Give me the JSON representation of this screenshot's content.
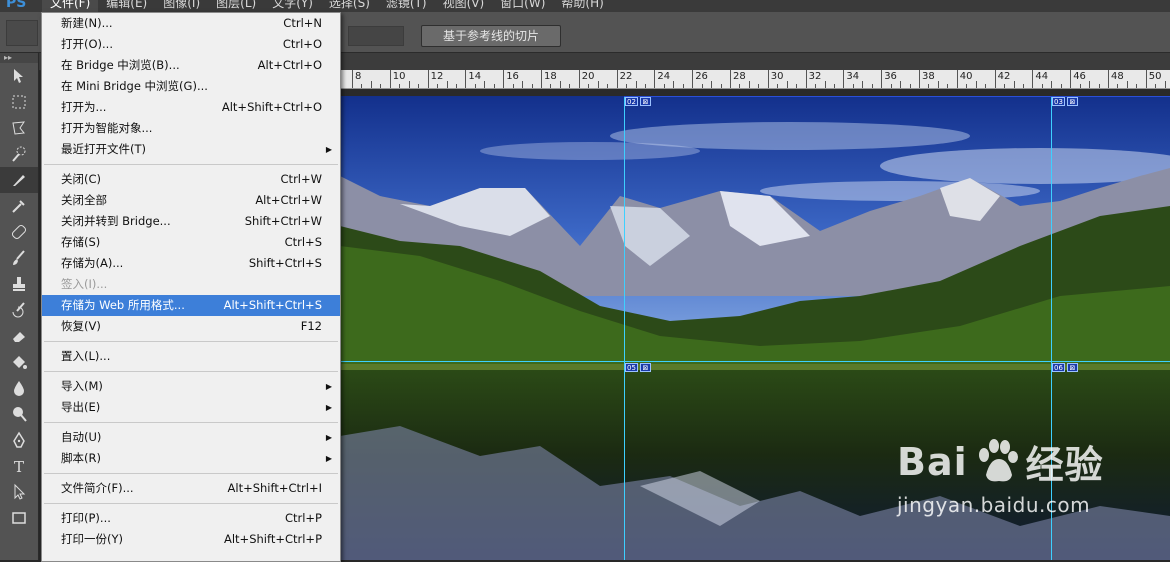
{
  "app": {
    "logo": "PS"
  },
  "menubar": {
    "items": [
      "文件(F)",
      "编辑(E)",
      "图像(I)",
      "图层(L)",
      "文字(Y)",
      "选择(S)",
      "滤镜(T)",
      "视图(V)",
      "窗口(W)",
      "帮助(H)"
    ]
  },
  "options_bar": {
    "slice_from_guides_label": "基于参考线的切片"
  },
  "ruler": {
    "labels": [
      "8",
      "10",
      "12",
      "14",
      "16",
      "18",
      "20",
      "22",
      "24",
      "26",
      "28",
      "30",
      "32",
      "34",
      "36",
      "38",
      "40",
      "42",
      "44",
      "46",
      "48",
      "50"
    ]
  },
  "slices": [
    {
      "num": "02"
    },
    {
      "num": "03"
    },
    {
      "num": "05"
    },
    {
      "num": "06"
    }
  ],
  "file_menu": {
    "items": [
      {
        "label": "新建(N)...",
        "shortcut": "Ctrl+N"
      },
      {
        "label": "打开(O)...",
        "shortcut": "Ctrl+O"
      },
      {
        "label": "在 Bridge 中浏览(B)...",
        "shortcut": "Alt+Ctrl+O"
      },
      {
        "label": "在 Mini Bridge 中浏览(G)...",
        "shortcut": ""
      },
      {
        "label": "打开为...",
        "shortcut": "Alt+Shift+Ctrl+O"
      },
      {
        "label": "打开为智能对象...",
        "shortcut": ""
      },
      {
        "label": "最近打开文件(T)",
        "shortcut": "",
        "submenu": true
      },
      {
        "sep": true
      },
      {
        "label": "关闭(C)",
        "shortcut": "Ctrl+W"
      },
      {
        "label": "关闭全部",
        "shortcut": "Alt+Ctrl+W"
      },
      {
        "label": "关闭并转到 Bridge...",
        "shortcut": "Shift+Ctrl+W"
      },
      {
        "label": "存储(S)",
        "shortcut": "Ctrl+S"
      },
      {
        "label": "存储为(A)...",
        "shortcut": "Shift+Ctrl+S"
      },
      {
        "label": "签入(I)...",
        "shortcut": "",
        "disabled": true
      },
      {
        "label": "存储为 Web 所用格式...",
        "shortcut": "Alt+Shift+Ctrl+S",
        "highlighted": true
      },
      {
        "label": "恢复(V)",
        "shortcut": "F12"
      },
      {
        "sep": true
      },
      {
        "label": "置入(L)...",
        "shortcut": ""
      },
      {
        "sep": true
      },
      {
        "label": "导入(M)",
        "shortcut": "",
        "submenu": true
      },
      {
        "label": "导出(E)",
        "shortcut": "",
        "submenu": true
      },
      {
        "sep": true
      },
      {
        "label": "自动(U)",
        "shortcut": "",
        "submenu": true
      },
      {
        "label": "脚本(R)",
        "shortcut": "",
        "submenu": true
      },
      {
        "sep": true
      },
      {
        "label": "文件简介(F)...",
        "shortcut": "Alt+Shift+Ctrl+I"
      },
      {
        "sep": true
      },
      {
        "label": "打印(P)...",
        "shortcut": "Ctrl+P"
      },
      {
        "label": "打印一份(Y)",
        "shortcut": "Alt+Shift+Ctrl+P"
      }
    ]
  },
  "watermark": {
    "brand_left": "Bai",
    "brand_right": "经验",
    "url": "jingyan.baidu.com"
  },
  "colors": {
    "highlight": "#3d7fd9",
    "guide": "#3dd0ff",
    "slice_tag": "#1a3aa8"
  }
}
